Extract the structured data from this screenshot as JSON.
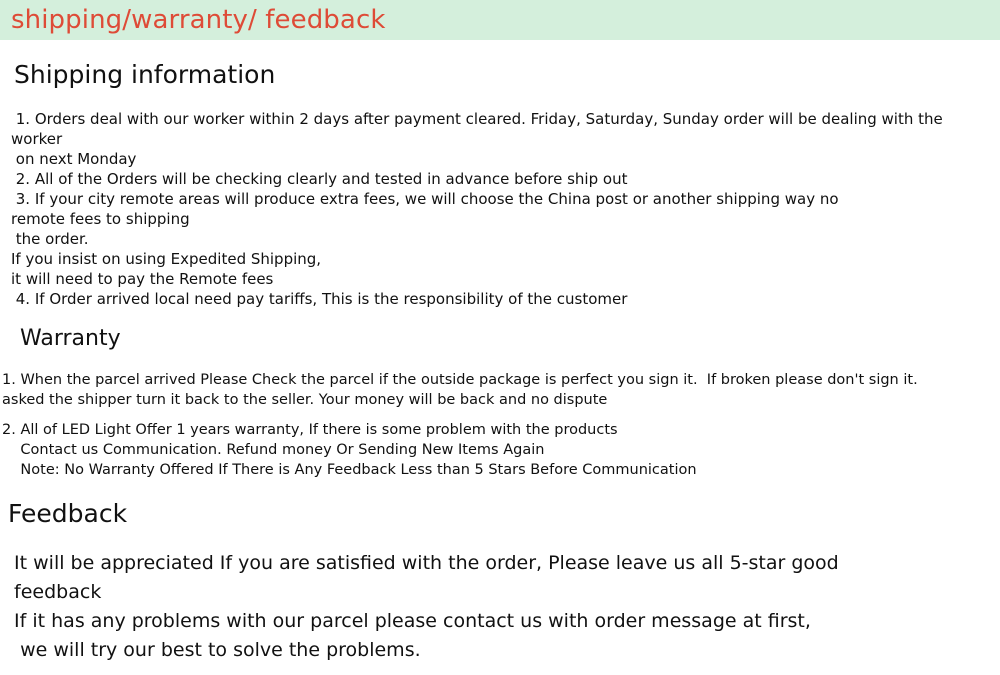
{
  "banner": {
    "title": "shipping/warranty/ feedback",
    "background_color": "#d4efdc",
    "text_color": "#de4b37"
  },
  "shipping": {
    "heading": "Shipping information",
    "lines": [
      " 1. Orders deal with our worker within 2 days after payment cleared. Friday, Saturday, Sunday order will be dealing with the",
      "worker",
      " on next Monday",
      " 2. All of the Orders will be checking clearly and tested in advance before ship out",
      " 3. If your city remote areas will produce extra fees, we will choose the China post or another shipping way no",
      "remote fees to shipping",
      " the order.",
      "If you insist on using Expedited Shipping,",
      "it will need to pay the Remote fees",
      " 4. If Order arrived local need pay tariffs, This is the responsibility of the customer"
    ]
  },
  "warranty": {
    "heading": "Warranty",
    "lines_group_one": [
      "1. When the parcel arrived Please Check the parcel if the outside package is perfect you sign it.  If broken please don't sign it.",
      "asked the shipper turn it back to the seller. Your money will be back and no dispute"
    ],
    "lines_group_two": [
      "2. All of LED Light Offer 1 years warranty, If there is some problem with the products",
      "    Contact us Communication. Refund money Or Sending New Items Again",
      "    Note: No Warranty Offered If There is Any Feedback Less than 5 Stars Before Communication"
    ]
  },
  "feedback": {
    "heading": "Feedback",
    "lines": [
      " It will be appreciated If you are satisfied with the order, Please leave us all 5-star good",
      " feedback",
      " If it has any problems with our parcel please contact us with order message at first,",
      "  we will try our best to solve the problems."
    ]
  }
}
